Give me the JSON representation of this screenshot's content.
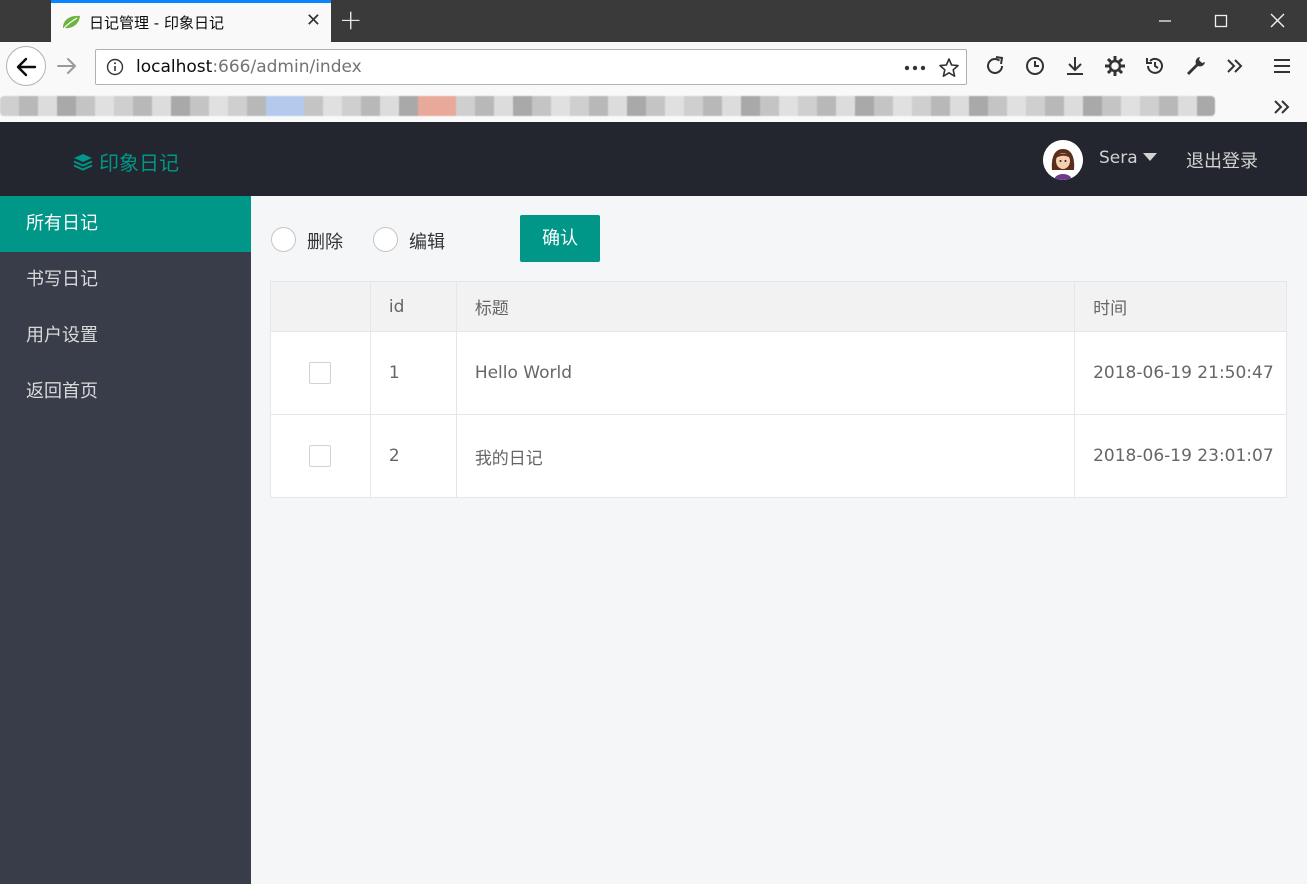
{
  "browser": {
    "tab_title": "日记管理 - 印象日记",
    "tab_close": "✕",
    "new_tab": "+",
    "url_host": "localhost",
    "url_rest": ":666/admin/index"
  },
  "header": {
    "logo_text": "印象日记",
    "user_name": "Sera",
    "logout_label": "退出登录"
  },
  "sidebar": {
    "items": [
      {
        "label": "所有日记",
        "active": true
      },
      {
        "label": "书写日记",
        "active": false
      },
      {
        "label": "用户设置",
        "active": false
      },
      {
        "label": "返回首页",
        "active": false
      }
    ]
  },
  "toolbar": {
    "delete_label": "删除",
    "edit_label": "编辑",
    "confirm_label": "确认"
  },
  "table": {
    "headers": [
      "",
      "id",
      "标题",
      "时间"
    ],
    "rows": [
      {
        "id": "1",
        "title": "Hello World",
        "time": "2018-06-19 21:50:47"
      },
      {
        "id": "2",
        "title": "我的日记",
        "time": "2018-06-19 23:01:07"
      }
    ]
  },
  "colors": {
    "accent": "#009688",
    "header_bg": "#23262e",
    "sidebar_bg": "#393d49"
  }
}
